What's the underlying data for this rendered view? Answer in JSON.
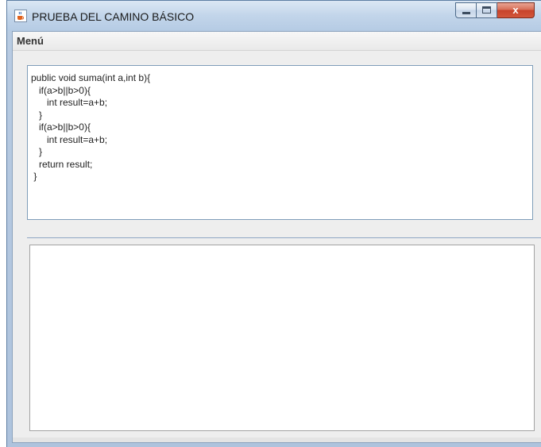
{
  "window": {
    "title": "PRUEBA DEL CAMINO BÁSICO",
    "icon": "java-cup-icon",
    "controls": [
      "minimize",
      "maximize",
      "close"
    ],
    "close_glyph": "x"
  },
  "menubar": {
    "items": [
      {
        "label": "Menú"
      }
    ]
  },
  "code_panel": {
    "text": "public void suma(int a,int b){\n   if(a>b||b>0){\n      int result=a+b;\n   }\n   if(a>b||b>0){\n      int result=a+b;\n   }\n   return result;\n }"
  },
  "output_panel": {
    "text": ""
  },
  "colors": {
    "title_bar": "#c2d5ea",
    "close_button": "#c7432a",
    "client_bg": "#eeeeee",
    "text_area_border": "#7f9db9"
  }
}
